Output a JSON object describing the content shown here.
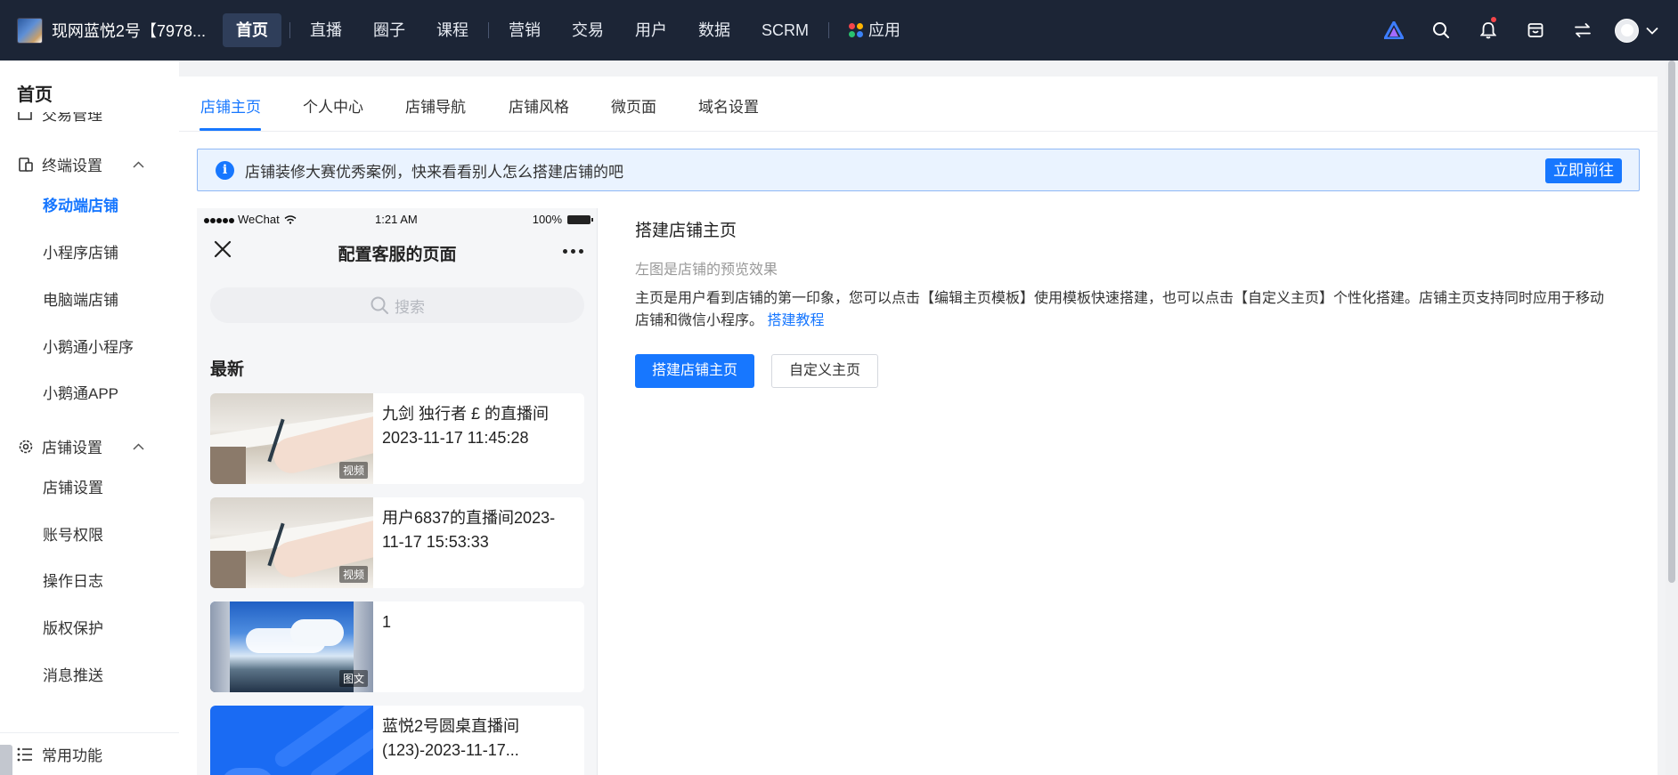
{
  "topbar": {
    "account_name": "现网蓝悦2号【7978...",
    "nav": [
      {
        "label": "首页",
        "active": true
      },
      {
        "label": "直播"
      },
      {
        "label": "圈子"
      },
      {
        "label": "课程"
      },
      {
        "label": "营销"
      },
      {
        "label": "交易"
      },
      {
        "label": "用户"
      },
      {
        "label": "数据"
      },
      {
        "label": "SCRM"
      },
      {
        "label": "应用"
      }
    ],
    "icons": [
      "brand-icon",
      "search-icon",
      "bell-icon",
      "store-icon",
      "switch-icon",
      "avatar"
    ]
  },
  "sidebar": {
    "title": "首页",
    "cut_item": "交易管理",
    "group_terminal": "终端设置",
    "terminal_items": [
      "移动端店铺",
      "小程序店铺",
      "电脑端店铺",
      "小鹅通小程序",
      "小鹅通APP"
    ],
    "group_store": "店铺设置",
    "store_items": [
      "店铺设置",
      "账号权限",
      "操作日志",
      "版权保护",
      "消息推送"
    ],
    "footer": "常用功能"
  },
  "tabs": [
    "店铺主页",
    "个人中心",
    "店铺导航",
    "店铺风格",
    "微页面",
    "域名设置"
  ],
  "notice": {
    "text": "店铺装修大赛优秀案例，快来看看别人怎么搭建店铺的吧",
    "button": "立即前往"
  },
  "phone": {
    "status_left": "WeChat",
    "status_time": "1:21 AM",
    "status_battery": "100%",
    "title": "配置客服的页面",
    "search_placeholder": "搜索",
    "section": "最新",
    "cards": [
      {
        "title": "九剑 独行者 £ 的直播间2023-11-17 11:45:28",
        "badge": "视频"
      },
      {
        "title": "用户6837的直播间2023-11-17 15:53:33",
        "badge": "视频"
      },
      {
        "title": "1",
        "badge": "图文"
      },
      {
        "title": "蓝悦2号圆桌直播间(123)-2023-11-17...",
        "badge": ""
      }
    ]
  },
  "content": {
    "title": "搭建店铺主页",
    "subtitle": "左图是店铺的预览效果",
    "description": "主页是用户看到店铺的第一印象，您可以点击【编辑主页模板】使用模板快速搭建，也可以点击【自定义主页】个性化搭建。店铺主页支持同时应用于移动店铺和微信小程序。",
    "link": "搭建教程",
    "primary_button": "搭建店铺主页",
    "secondary_button": "自定义主页"
  },
  "colors": {
    "accent": "#1777ff",
    "topbar": "#1c2536",
    "notice_bg": "#eaf3ff"
  }
}
